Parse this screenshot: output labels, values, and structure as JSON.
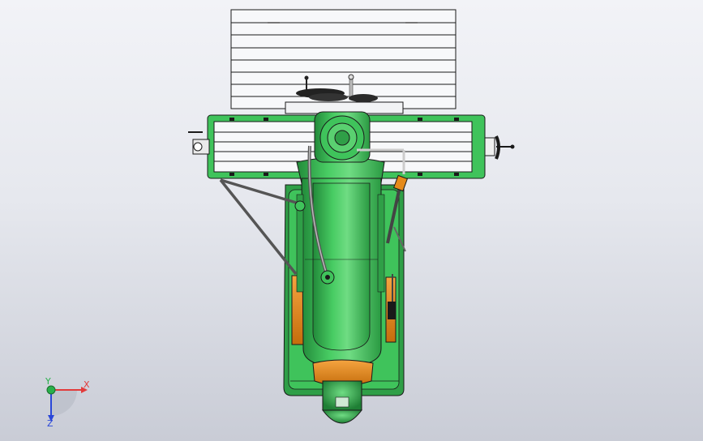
{
  "viewport": {
    "background_top": "#f2f3f7",
    "background_bottom": "#c9ccd6"
  },
  "model": {
    "name_visible": false,
    "colors": {
      "body_green": "#3fc35b",
      "dark_green": "#228a3a",
      "highlight_green": "#8ee79e",
      "table_white": "#f5f6f8",
      "orange": "#e58a1a",
      "outline": "#1a1a1a"
    }
  },
  "triad": {
    "x_label": "X",
    "y_label": "Y",
    "z_label": "Z",
    "x_color": "#e23b3b",
    "y_color": "#28b04a",
    "z_color": "#2a47d8"
  }
}
